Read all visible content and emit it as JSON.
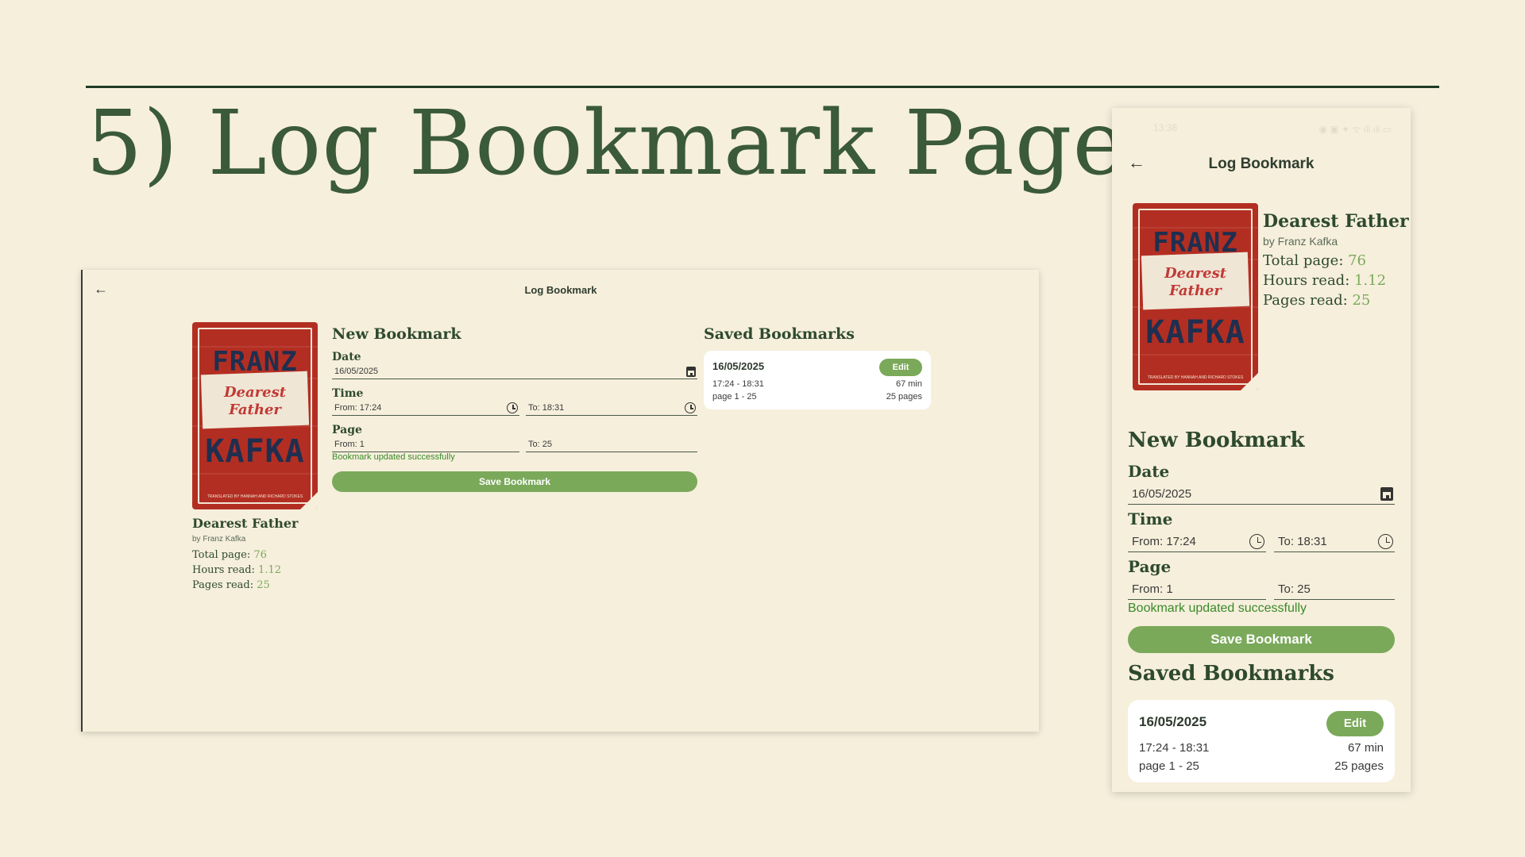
{
  "slide": {
    "title": "5) Log Bookmark Page"
  },
  "colors": {
    "background": "#f6efdc",
    "accent": "#7aa95a",
    "dark_green": "#2e4a2e",
    "success": "#3a8a2a",
    "cover_red": "#b32e22"
  },
  "app": {
    "title": "Log Bookmark",
    "back_icon": "arrow-left-icon"
  },
  "book": {
    "title": "Dearest Father",
    "author": "by Franz Kafka",
    "cover": {
      "line1": "FRANZ",
      "line2a": "Dearest",
      "line2b": "Father",
      "line3": "KAFKA",
      "credit": "TRANSLATED BY HANNAH AND RICHARD STOKES"
    },
    "stats": [
      {
        "label": "Total page: ",
        "value": "76"
      },
      {
        "label": "Hours read: ",
        "value": "1.12"
      },
      {
        "label": "Pages read: ",
        "value": "25"
      }
    ]
  },
  "form": {
    "heading": "New Bookmark",
    "date_label": "Date",
    "date_value": "16/05/2025",
    "time_label": "Time",
    "time_from": "From: 17:24",
    "time_to": "To: 18:31",
    "page_label": "Page",
    "page_from": "From: 1",
    "page_to": "To: 25",
    "success_message": "Bookmark updated successfully",
    "save_label": "Save Bookmark"
  },
  "saved": {
    "heading": "Saved Bookmarks",
    "items": [
      {
        "date": "16/05/2025",
        "time_range": "17:24 - 18:31",
        "duration": "67 min",
        "page_range": "page 1 - 25",
        "pages": "25 pages",
        "edit_label": "Edit"
      }
    ]
  },
  "phone": {
    "status_time": "13:38",
    "status_icons": "◉ ▣ ✦ ᯤ ıll ıll ▭"
  }
}
